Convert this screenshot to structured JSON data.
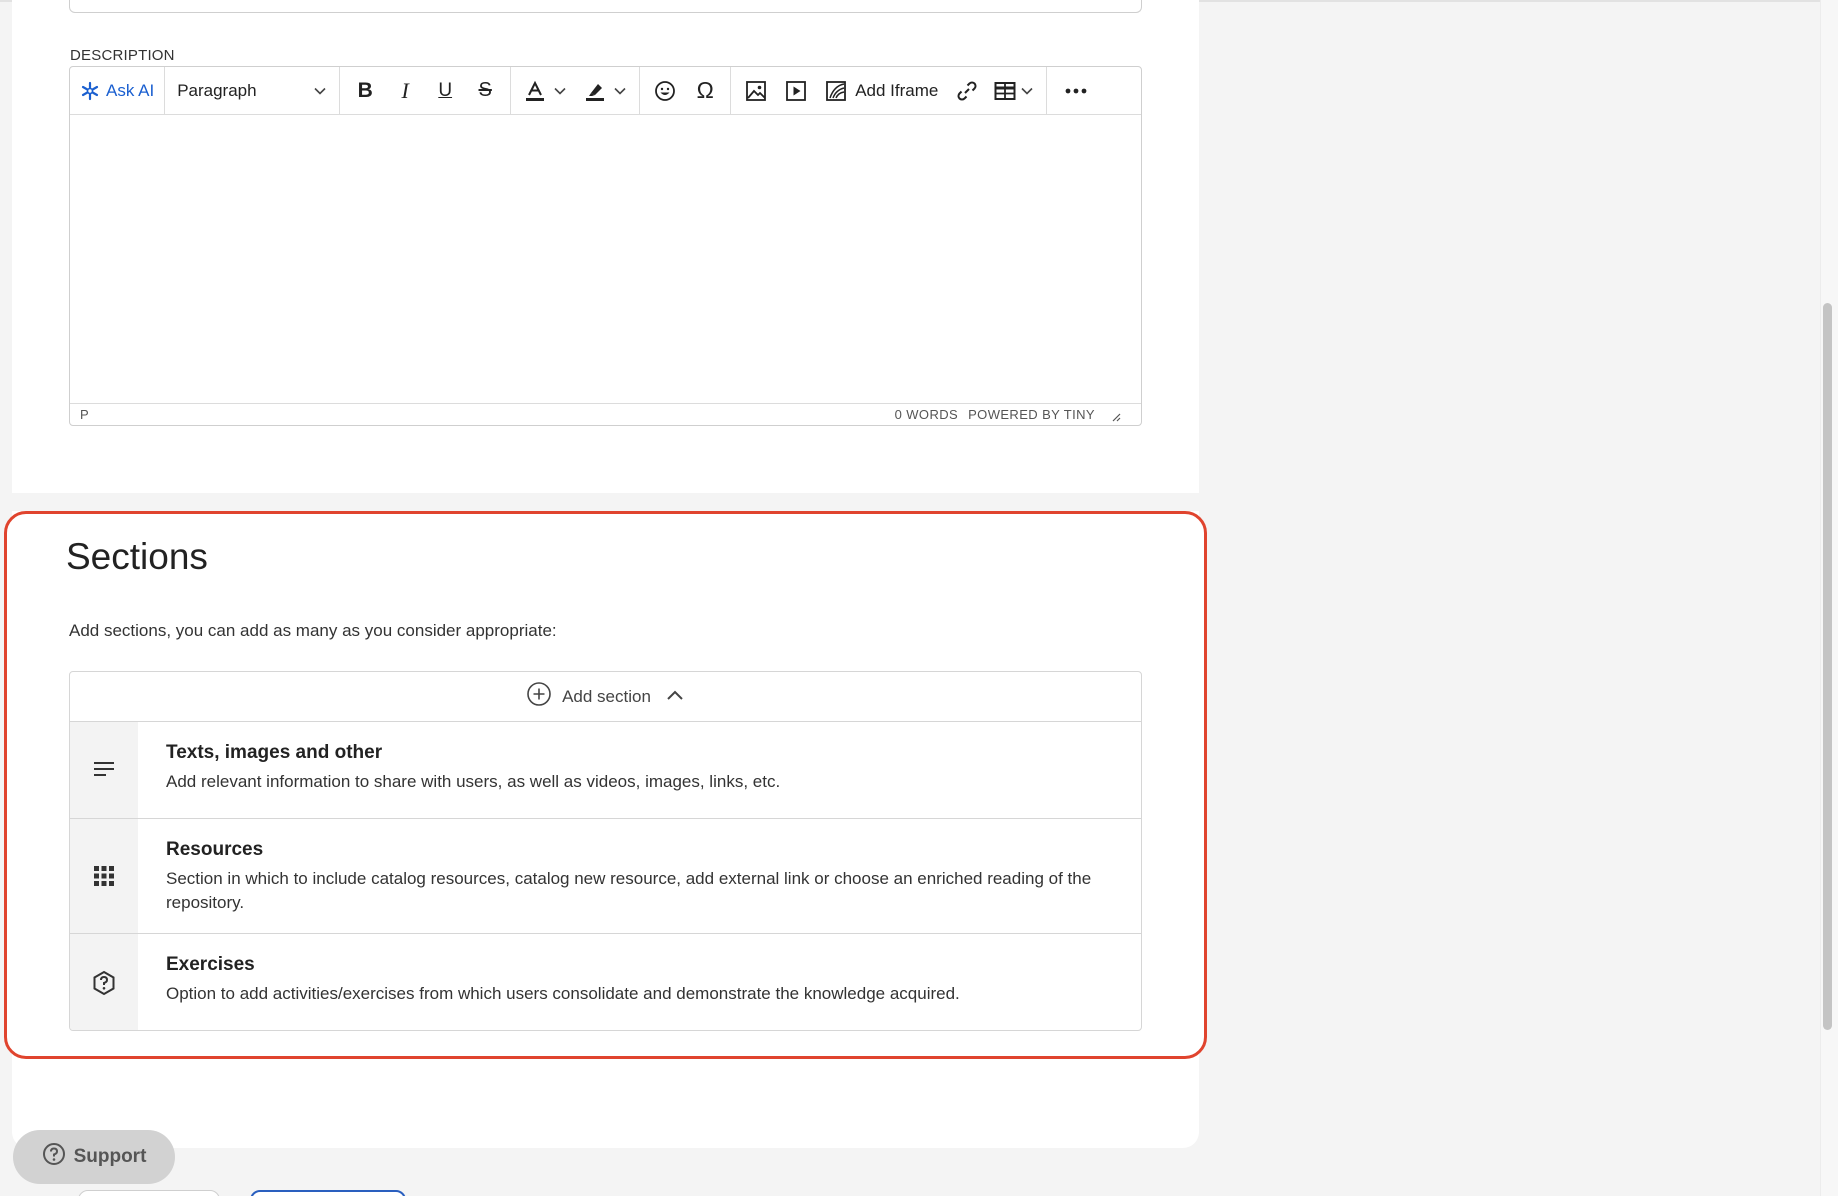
{
  "description": {
    "label": "DESCRIPTION"
  },
  "editor": {
    "toolbar": {
      "ask_ai": "Ask AI",
      "format_value": "Paragraph",
      "add_iframe": "Add Iframe"
    },
    "status": {
      "element_path": "P",
      "word_count": "0 WORDS",
      "powered_by": "POWERED BY TINY"
    },
    "accent_color": "#1a5fd0"
  },
  "sections": {
    "title": "Sections",
    "intro": "Add sections, you can add as many as you consider appropriate:",
    "add_label": "Add section",
    "highlight_color": "#e0442e",
    "items": [
      {
        "icon": "text-lines-icon",
        "title": "Texts, images and other",
        "description": "Add relevant information to share with users, as well as videos, images, links, etc."
      },
      {
        "icon": "grid-dots-icon",
        "title": "Resources",
        "description": "Section in which to include catalog resources, catalog new resource, add external link or choose an enriched reading of the repository."
      },
      {
        "icon": "hexagon-question-icon",
        "title": "Exercises",
        "description": "Option to add activities/exercises from which users consolidate and demonstrate the knowledge acquired."
      }
    ]
  },
  "support": {
    "label": "Support"
  }
}
